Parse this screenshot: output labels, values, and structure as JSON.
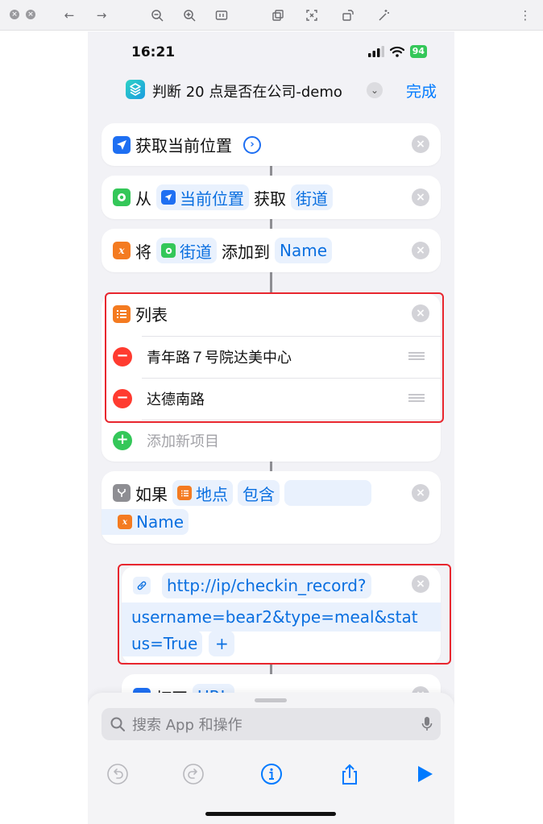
{
  "viewer": {
    "icons": [
      "close-dot-icon",
      "close-dot-icon",
      "back-arrow-icon",
      "forward-arrow-icon",
      "zoom-out-icon",
      "zoom-in-icon",
      "fit-icon",
      "copy-icon",
      "capture-icon",
      "rotate-icon",
      "magic-icon",
      "more-icon"
    ]
  },
  "status": {
    "time": "16:21",
    "battery": "94"
  },
  "nav": {
    "title": "判断 20 点是否在公司-demo",
    "done": "完成"
  },
  "actions": {
    "get_location": {
      "label": "获取当前位置"
    },
    "get_detail": {
      "prefix": "从",
      "var": "当前位置",
      "middle": "获取",
      "field": "街道"
    },
    "add_to": {
      "prefix": "将",
      "var": "街道",
      "middle": "添加到",
      "target": "Name"
    },
    "list": {
      "title": "列表",
      "items": [
        "青年路７号院达美中心",
        "达德南路"
      ],
      "add_label": "添加新项目"
    },
    "if": {
      "prefix": "如果",
      "var": "地点",
      "condition": "包含",
      "value": "Name"
    },
    "url": {
      "line1": "http://ip/checkin_record?",
      "line2": "username=bear2&type=meal&stat",
      "line3": "us=True",
      "plus": "+"
    },
    "open": {
      "prefix": "打开",
      "var": "URL"
    }
  },
  "search": {
    "placeholder": "搜索 App 和操作"
  },
  "colors": {
    "accent": "#007aff",
    "highlight": "#e8262e"
  }
}
